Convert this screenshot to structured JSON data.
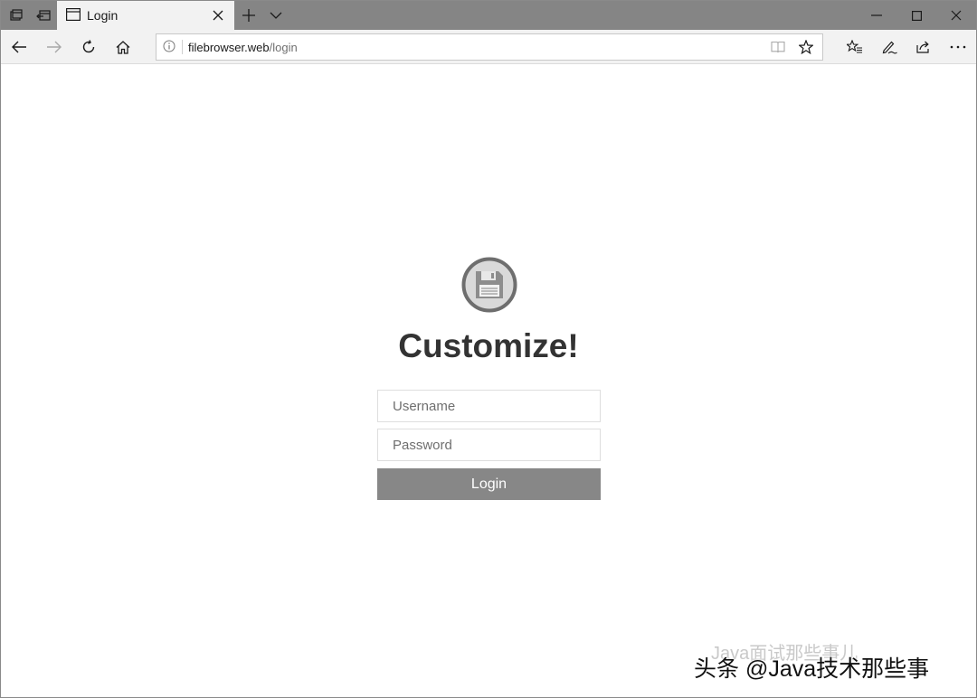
{
  "browser": {
    "tab": {
      "title": "Login",
      "icon": "page-icon"
    },
    "address": {
      "domain": "filebrowser.web",
      "path": "/login"
    },
    "icons": {
      "tab_preview": "tab-preview-icon",
      "set_aside": "set-aside-tabs-icon",
      "new_tab": "plus-icon",
      "tab_list": "chevron-down-icon",
      "back": "back-arrow-icon",
      "forward": "forward-arrow-icon",
      "refresh": "refresh-icon",
      "home": "home-icon",
      "reading_view": "reading-view-icon",
      "favorite": "star-icon",
      "favorites_hub": "favorites-hub-icon",
      "notes": "pen-icon",
      "share": "share-icon",
      "more": "more-icon"
    }
  },
  "login": {
    "heading": "Customize!",
    "username_placeholder": "Username",
    "password_placeholder": "Password",
    "submit_label": "Login",
    "logo_icon": "floppy-disk-icon"
  },
  "watermark": {
    "main": "头条 @Java技术那些事",
    "faint": "Java面试那些事儿"
  },
  "colors": {
    "tabbar": "#858585",
    "navbar": "#f2f2f2",
    "button": "#878787",
    "heading": "#333333"
  }
}
